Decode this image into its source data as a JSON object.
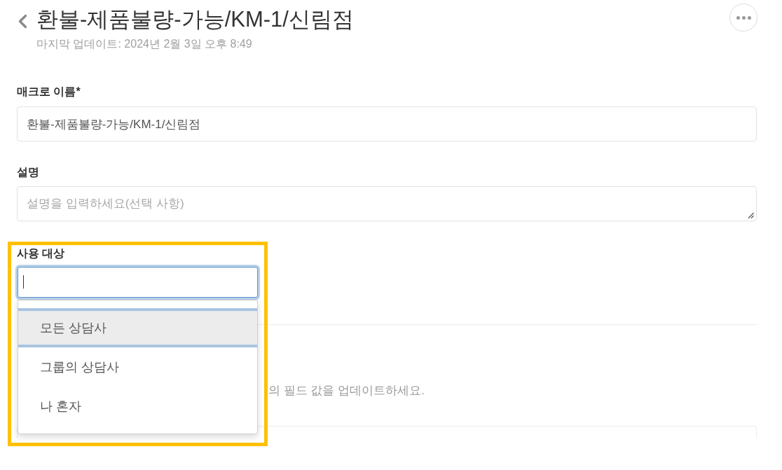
{
  "header": {
    "title": "환불-제품불량-가능/KM-1/신림점",
    "subtitle": "마지막 업데이트: 2024년 2월 3일 오후 8:49"
  },
  "form": {
    "fields": [
      {
        "kind": "input",
        "label": "매크로 이름*",
        "value": "환불-제품불량-가능/KM-1/신림점"
      },
      {
        "kind": "textarea",
        "label": "설명",
        "placeholder": "설명을 입력하세요(선택 사항)"
      }
    ]
  },
  "audience": {
    "label": "사용 대상",
    "highlighted": true,
    "focused": true,
    "expanded": true,
    "options": [
      {
        "label": "모든 상담사",
        "selected": true
      },
      {
        "label": "그룹의 상담사",
        "selected": false
      },
      {
        "label": "나 혼자",
        "selected": false
      }
    ]
  },
  "update_section": {
    "description": "의 필드 값을 업데이트하세요.",
    "fields": [
      {
        "kind": "input"
      }
    ]
  }
}
